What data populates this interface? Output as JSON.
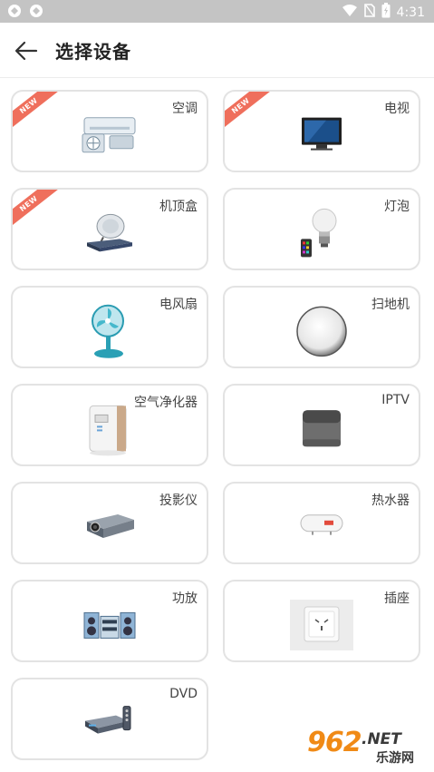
{
  "status_bar": {
    "time": "4:31",
    "icons": [
      "app-icon",
      "app-icon",
      "wifi-icon",
      "no-sim-icon",
      "battery-charging-icon"
    ]
  },
  "header": {
    "back_icon": "arrow-left-icon",
    "title": "选择设备"
  },
  "devices": [
    {
      "label": "空调",
      "icon": "air-conditioner-icon",
      "badge": "NEW"
    },
    {
      "label": "电视",
      "icon": "tv-icon",
      "badge": "NEW"
    },
    {
      "label": "机顶盒",
      "icon": "set-top-box-icon",
      "badge": "NEW"
    },
    {
      "label": "灯泡",
      "icon": "light-bulb-icon",
      "badge": ""
    },
    {
      "label": "电风扇",
      "icon": "electric-fan-icon",
      "badge": ""
    },
    {
      "label": "扫地机",
      "icon": "robot-vacuum-icon",
      "badge": ""
    },
    {
      "label": "空气净化器",
      "icon": "air-purifier-icon",
      "badge": ""
    },
    {
      "label": "IPTV",
      "icon": "iptv-box-icon",
      "badge": ""
    },
    {
      "label": "投影仪",
      "icon": "projector-icon",
      "badge": ""
    },
    {
      "label": "热水器",
      "icon": "water-heater-icon",
      "badge": ""
    },
    {
      "label": "功放",
      "icon": "amplifier-icon",
      "badge": ""
    },
    {
      "label": "插座",
      "icon": "power-socket-icon",
      "badge": ""
    },
    {
      "label": "DVD",
      "icon": "dvd-player-icon",
      "badge": ""
    }
  ],
  "watermark": {
    "number": "962",
    "suffix": ".NET",
    "site": "乐游网"
  },
  "colors": {
    "status_bar": "#c4c4c4",
    "badge": "#ef6f5c",
    "card_border": "#e3e3e3"
  }
}
